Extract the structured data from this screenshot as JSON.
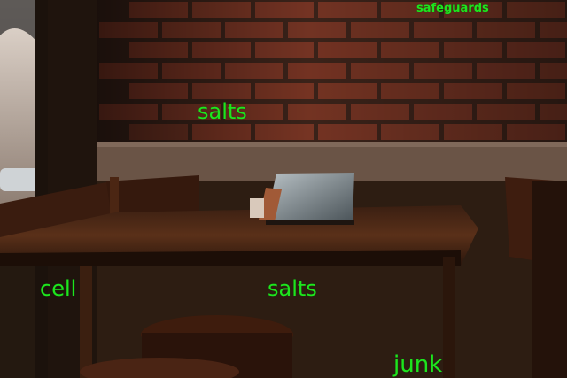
{
  "scene": {
    "description_icon": "cafe-table-photo",
    "colors": {
      "brick": "#7a3524",
      "mortar": "#3a2219",
      "wood": "#4e2a18",
      "label": "#1ee51e"
    }
  },
  "labels": [
    {
      "text": "safeguards"
    },
    {
      "text": "salts"
    },
    {
      "text": "cell"
    },
    {
      "text": "salts"
    },
    {
      "text": "junk"
    }
  ]
}
